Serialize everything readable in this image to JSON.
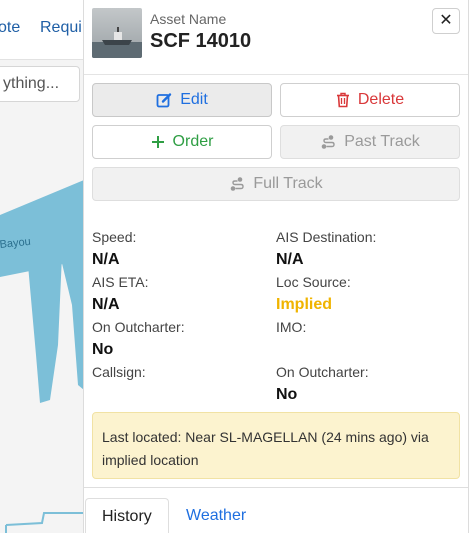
{
  "background": {
    "nav_items": [
      "ote",
      "Requi"
    ],
    "search_placeholder": "ything...",
    "map_label": "Bayou"
  },
  "panel": {
    "asset_label": "Asset Name",
    "asset_name": "SCF 14010",
    "close_glyph": "✕",
    "buttons": {
      "edit": "Edit",
      "delete": "Delete",
      "order": "Order",
      "past_track": "Past Track",
      "full_track": "Full Track"
    },
    "fields": {
      "speed": {
        "label": "Speed:",
        "value": "N/A"
      },
      "ais_destination": {
        "label": "AIS Destination:",
        "value": "N/A"
      },
      "ais_eta": {
        "label": "AIS ETA:",
        "value": "N/A"
      },
      "loc_source": {
        "label": "Loc Source:",
        "value": "Implied"
      },
      "on_outcharter_left": {
        "label": "On Outcharter:",
        "value": "No"
      },
      "imo": {
        "label": "IMO:",
        "value": ""
      },
      "callsign": {
        "label": "Callsign:",
        "value": ""
      },
      "on_outcharter_right": {
        "label": "On Outcharter:",
        "value": "No"
      }
    },
    "alert_text": "Last located: Near SL-MAGELLAN (24 mins ago) via implied location",
    "tabs": {
      "history": "History",
      "weather": "Weather"
    }
  },
  "colors": {
    "link_blue": "#1f6fe0",
    "danger_red": "#d9383a",
    "success_green": "#2f9e44",
    "implied_amber": "#f0b400",
    "alert_bg": "#fcf3cf",
    "water": "#7cbfd8"
  },
  "icons": {
    "edit": "edit-icon",
    "delete": "trash-icon",
    "order": "plus-icon",
    "past_track": "route-icon",
    "full_track": "route-icon",
    "close": "close-icon"
  }
}
